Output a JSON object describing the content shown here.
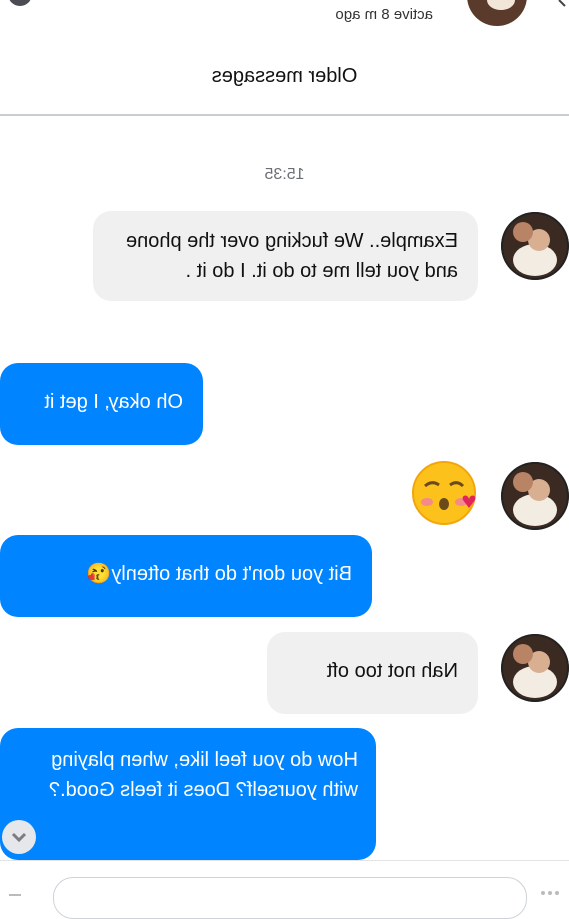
{
  "header": {
    "status": "active 8 m ago"
  },
  "older_messages": "Older messages",
  "timestamp": "15:35",
  "messages": [
    {
      "sender": "them",
      "text": "Example.. We fucking over the phone and you tell me to do it. I do it ."
    },
    {
      "sender": "me",
      "text": "Oh okay, I get it"
    },
    {
      "sender": "them",
      "text": "😘"
    },
    {
      "sender": "me",
      "text": "Bit you don't do that oftenly😘"
    },
    {
      "sender": "them",
      "text": "Nah not too oft"
    },
    {
      "sender": "me",
      "text": "How do you feel like, when playing with yourself? Does it feels Good.?"
    }
  ],
  "colors": {
    "outgoing_bubble": "#0084ff",
    "incoming_bubble": "#f1f0f0",
    "timestamp": "#6b6f75"
  }
}
